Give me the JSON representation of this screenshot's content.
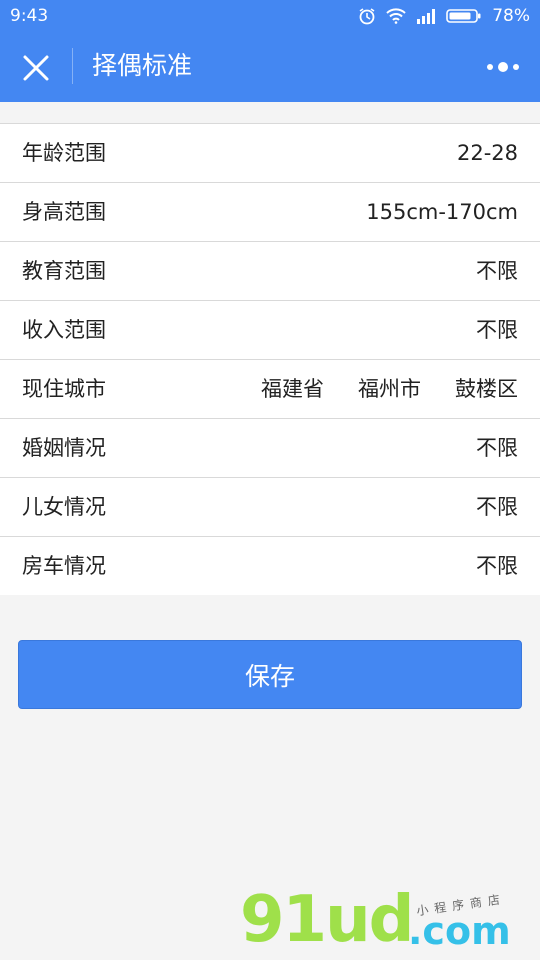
{
  "statusbar": {
    "time": "9:43",
    "battery": "78%"
  },
  "navbar": {
    "title": "择偶标准"
  },
  "rows": [
    {
      "label": "年龄范围",
      "value": "22-28"
    },
    {
      "label": "身高范围",
      "value": "155cm-170cm"
    },
    {
      "label": "教育范围",
      "value": "不限"
    },
    {
      "label": "收入范围",
      "value": "不限"
    },
    {
      "label": "现住城市",
      "province": "福建省",
      "city": "福州市",
      "district": "鼓楼区"
    },
    {
      "label": "婚姻情况",
      "value": "不限"
    },
    {
      "label": "儿女情况",
      "value": "不限"
    },
    {
      "label": "房车情况",
      "value": "不限"
    }
  ],
  "save_label": "保存",
  "watermark": {
    "main": "91ud",
    "com": ".com",
    "sub": "小程序商店"
  },
  "colors": {
    "primary": "#4487f2",
    "background": "#f4f4f4"
  }
}
